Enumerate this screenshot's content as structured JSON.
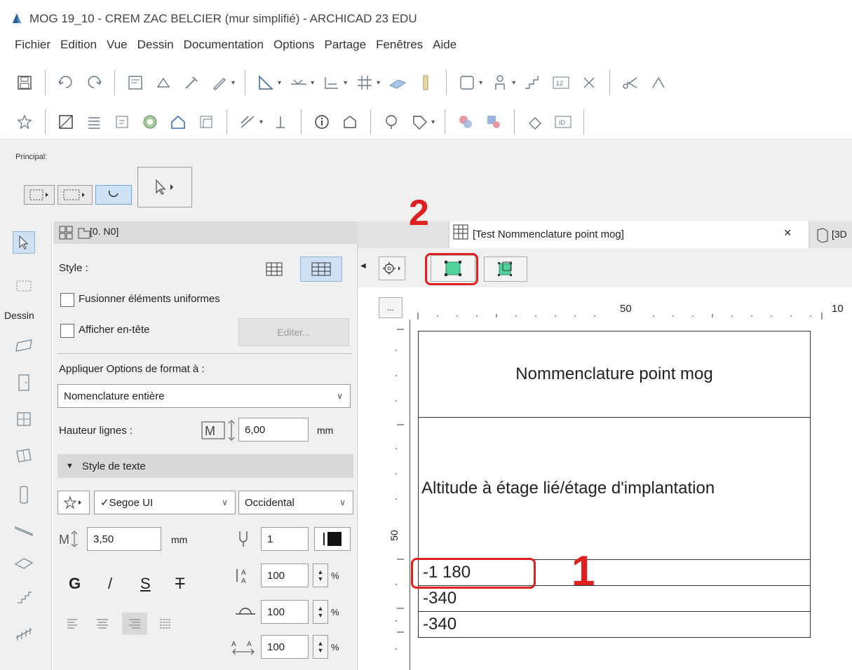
{
  "window": {
    "title": "MOG 19_10 - CREM ZAC BELCIER (mur simplifié) - ARCHICAD 23 EDU"
  },
  "menu": [
    "Fichier",
    "Edition",
    "Vue",
    "Dessin",
    "Documentation",
    "Options",
    "Partage",
    "Fenêtres",
    "Aide"
  ],
  "toolbar1": [
    "save-icon",
    "undo-icon",
    "redo-icon",
    "sep",
    "layer-icon",
    "level-icon",
    "eyedropper-icon",
    "pen-icon",
    "sep",
    "line-icon",
    "dimension-icon",
    "slab-icon",
    "grid-icon",
    "beam-icon",
    "column-icon",
    "sep",
    "object-icon",
    "person-icon",
    "stair-icon",
    "label-icon",
    "snap-icon",
    "sep",
    "cut-icon",
    "magnet-icon"
  ],
  "toolbar2": [
    "favorite-icon",
    "plan-icon",
    "layers-icon",
    "view-map-icon",
    "render-icon",
    "3d-house-icon",
    "3d-print-icon",
    "sep",
    "renovation-icon",
    "elevation-icon",
    "sep",
    "info-icon",
    "properties-icon",
    "sep",
    "tree-icon",
    "tag-icon",
    "sep",
    "graphic-override-icon",
    "palette-icon",
    "sep",
    "shape-icon",
    "id-icon"
  ],
  "principal": {
    "label": "Principal:"
  },
  "toolbox": {
    "dessin_label": "Dessin"
  },
  "panel": {
    "tab_label": "[0. N0]",
    "style_label": "Style :",
    "fusion_label": "Fusionner éléments uniformes",
    "entete_label": "Afficher en-tête",
    "editer_label": "Editer...",
    "apply_label": "Appliquer Options de format à :",
    "apply_value": "Nomenclature entière",
    "hauteur_label": "Hauteur lignes :",
    "hauteur_value": "6,00",
    "unit_mm": "mm",
    "text_style_header": "Style de texte",
    "font_value": "✓Segoe UI",
    "script_value": "Occidental",
    "text_size_value": "3,50",
    "pen_value": "1",
    "bold": "G",
    "italic": "/",
    "underline": "S",
    "strike": "T",
    "width_value": "100",
    "height_value": "100",
    "spacing_value": "100",
    "percent": "%"
  },
  "doc": {
    "tab_label": "[Test  Nommenclature point mog]",
    "tab_close": "×",
    "next_tab_label": "[3D"
  },
  "ruler": {
    "top_50": "50",
    "top_100": "10",
    "left_50": "50"
  },
  "table": {
    "title": "Nommenclature point mog",
    "header": "Altitude à étage lié/étage d'implantation",
    "rows": [
      "-1 180",
      "-340",
      "-340"
    ]
  },
  "annotations": {
    "step1": "1",
    "step2": "2",
    "accent": "#e02020"
  }
}
